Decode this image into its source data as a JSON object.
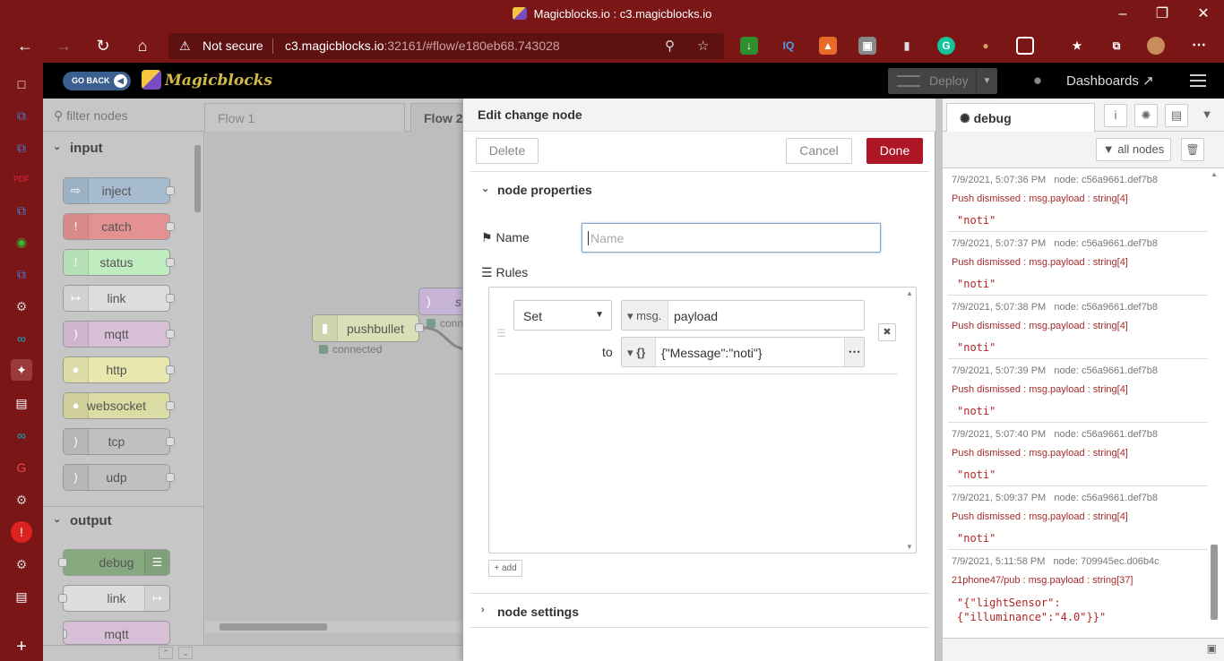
{
  "browser": {
    "window_title": "Magicblocks.io : c3.magicblocks.io",
    "security_label": "Not secure",
    "url_host": "c3.magicblocks.io",
    "url_rest": ":32161/#flow/e180eb68.743028"
  },
  "header": {
    "go_back": "GO BACK",
    "logo": "Magicblocks",
    "deploy": "Deploy",
    "dashboards": "Dashboards"
  },
  "palette": {
    "filter_placeholder": "filter nodes",
    "input_label": "input",
    "input_nodes": [
      "inject",
      "catch",
      "status",
      "link",
      "mqtt",
      "http",
      "websocket",
      "tcp",
      "udp"
    ],
    "output_label": "output",
    "output_nodes": [
      "debug",
      "link",
      "mqtt"
    ]
  },
  "workspace": {
    "tabs": [
      "Flow 1",
      "Flow 2"
    ],
    "pushbullet_label": "pushbullet",
    "status_connected": "connected",
    "partial_node_label": "s",
    "partial_status": "conn"
  },
  "editor": {
    "title": "Edit change node",
    "delete": "Delete",
    "cancel": "Cancel",
    "done": "Done",
    "node_properties": "node properties",
    "name_label": "Name",
    "name_placeholder": "Name",
    "rules_label": "Rules",
    "rule": {
      "action": "Set",
      "target_type": "msg.",
      "target_value": "payload",
      "to_label": "to",
      "value_type": "{}",
      "value": "{\"Message\":\"noti\"}"
    },
    "add": "add",
    "node_settings": "node settings"
  },
  "sidebar": {
    "tab": "debug",
    "all_nodes": "all nodes",
    "messages": [
      {
        "time": "7/9/2021, 5:07:36 PM",
        "node": "node: c56a9661.def7b8",
        "topic": "Push dismissed : msg.payload : string[4]",
        "body": "\"noti\""
      },
      {
        "time": "7/9/2021, 5:07:37 PM",
        "node": "node: c56a9661.def7b8",
        "topic": "Push dismissed : msg.payload : string[4]",
        "body": "\"noti\""
      },
      {
        "time": "7/9/2021, 5:07:38 PM",
        "node": "node: c56a9661.def7b8",
        "topic": "Push dismissed : msg.payload : string[4]",
        "body": "\"noti\""
      },
      {
        "time": "7/9/2021, 5:07:39 PM",
        "node": "node: c56a9661.def7b8",
        "topic": "Push dismissed : msg.payload : string[4]",
        "body": "\"noti\""
      },
      {
        "time": "7/9/2021, 5:07:40 PM",
        "node": "node: c56a9661.def7b8",
        "topic": "Push dismissed : msg.payload : string[4]",
        "body": "\"noti\""
      },
      {
        "time": "7/9/2021, 5:09:37 PM",
        "node": "node: c56a9661.def7b8",
        "topic": "Push dismissed : msg.payload : string[4]",
        "body": "\"noti\""
      },
      {
        "time": "7/9/2021, 5:11:58 PM",
        "node": "node: 709945ec.d06b4c",
        "topic": "21phone47/pub : msg.payload : string[37]",
        "body": "\"{\"lightSensor\":\n{\"illuminance\":\"4.0\"}}\""
      }
    ]
  },
  "colors": {
    "browser_chrome": "#7a1616",
    "done_button": "#ad1625",
    "debug_topic": "#a52a2a"
  }
}
